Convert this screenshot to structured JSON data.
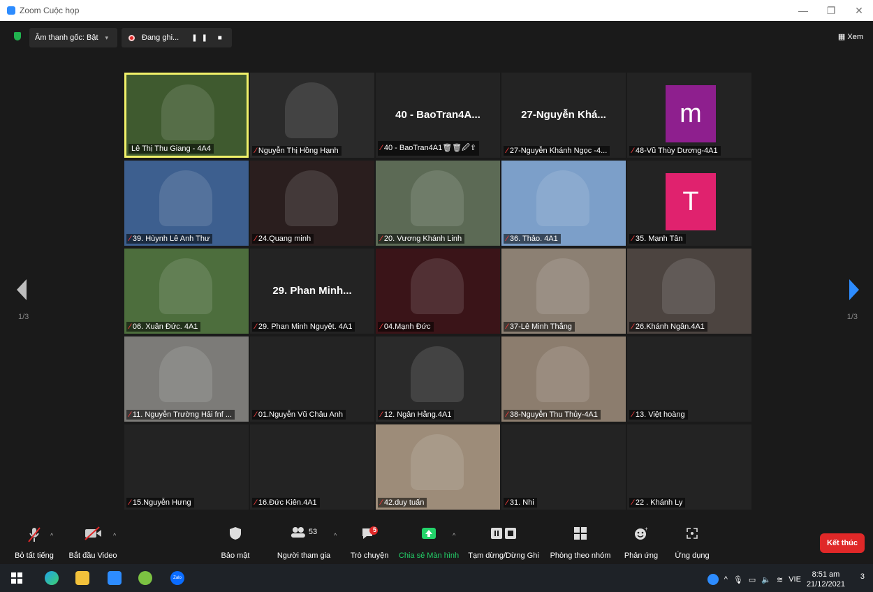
{
  "window": {
    "title": "Zoom Cuộc họp",
    "controls": [
      "—",
      "❐",
      "✕"
    ]
  },
  "topbar": {
    "audio_label": "Âm thanh gốc: Bật",
    "recording_label": "Đang ghi...",
    "recording_controls": "❚❚ ■",
    "view_label": "Xem"
  },
  "pagination": {
    "left": "1/3",
    "right": "1/3"
  },
  "participants": [
    {
      "name": "Lê Thị Thu Giang - 4A4",
      "big": "",
      "avatar": "",
      "active": true
    },
    {
      "name": "Nguyễn Thị Hồng Hạnh",
      "big": "",
      "avatar": ""
    },
    {
      "name": "40 - BaoTran4A1🗑🗑🖉⇧",
      "big": "40 - BaoTran4A...",
      "avatar": ""
    },
    {
      "name": "27-Nguyễn Khánh Ngọc -4...",
      "big": "27-Nguyễn Khá...",
      "avatar": ""
    },
    {
      "name": "48-Vũ Thùy Dương-4A1",
      "big": "",
      "avatar": "m",
      "avatar_color": "#8e1f8e"
    },
    {
      "name": "39. Hùynh Lê Anh Thư",
      "big": "",
      "avatar": ""
    },
    {
      "name": "24.Quang minh",
      "big": "",
      "avatar": ""
    },
    {
      "name": "20. Vương Khánh Linh",
      "big": "",
      "avatar": ""
    },
    {
      "name": "36. Thảo. 4A1",
      "big": "",
      "avatar": ""
    },
    {
      "name": "35. Mạnh Tân",
      "big": "",
      "avatar": "T",
      "avatar_color": "#e0226e"
    },
    {
      "name": "06. Xuân Đức. 4A1",
      "big": "",
      "avatar": ""
    },
    {
      "name": "29. Phan Minh Nguyệt. 4A1",
      "big": "29. Phan Minh...",
      "avatar": ""
    },
    {
      "name": "04.Mạnh Đức",
      "big": "",
      "avatar": ""
    },
    {
      "name": "37-Lê Minh Thắng",
      "big": "",
      "avatar": ""
    },
    {
      "name": "26.Khánh Ngân.4A1",
      "big": "",
      "avatar": ""
    },
    {
      "name": "11. Nguyễn Trường Hải fnf ...",
      "big": "",
      "avatar": ""
    },
    {
      "name": "01.Nguyễn Vũ Châu Anh",
      "big": "",
      "avatar": ""
    },
    {
      "name": "12. Ngân Hằng.4A1",
      "big": "",
      "avatar": ""
    },
    {
      "name": "38-Nguyễn Thu Thủy-4A1",
      "big": "",
      "avatar": ""
    },
    {
      "name": "13. Việt hoàng",
      "big": "",
      "avatar": ""
    },
    {
      "name": "15.Nguyễn Hưng",
      "big": "",
      "avatar": ""
    },
    {
      "name": "16.Đức Kiên.4A1",
      "big": "",
      "avatar": ""
    },
    {
      "name": "42.duy tuấn",
      "big": "",
      "avatar": ""
    },
    {
      "name": "31. Nhi",
      "big": "",
      "avatar": ""
    },
    {
      "name": "22 . Khánh Ly",
      "big": "",
      "avatar": ""
    }
  ],
  "toolbar": {
    "mute_all": "Bỏ tất tiếng",
    "start_video": "Bắt đầu Video",
    "security": "Bảo mật",
    "participants": "Người tham gia",
    "participant_count": "53",
    "chat": "Trò chuyện",
    "chat_badge": "5",
    "share": "Chia sẻ Màn hình",
    "pause_record": "Tạm dừng/Dừng Ghi",
    "breakout": "Phòng theo nhóm",
    "reactions": "Phản ứng",
    "apps": "Ứng dụng",
    "end": "Kết thúc"
  },
  "taskbar": {
    "language": "VIE",
    "time": "8:51 am",
    "date": "21/12/2021",
    "notifications": "3",
    "zalo": "Zalo"
  },
  "colors": {
    "accent_green": "#23d36a",
    "end_red": "#e02828",
    "active_border": "#f1f16a"
  }
}
